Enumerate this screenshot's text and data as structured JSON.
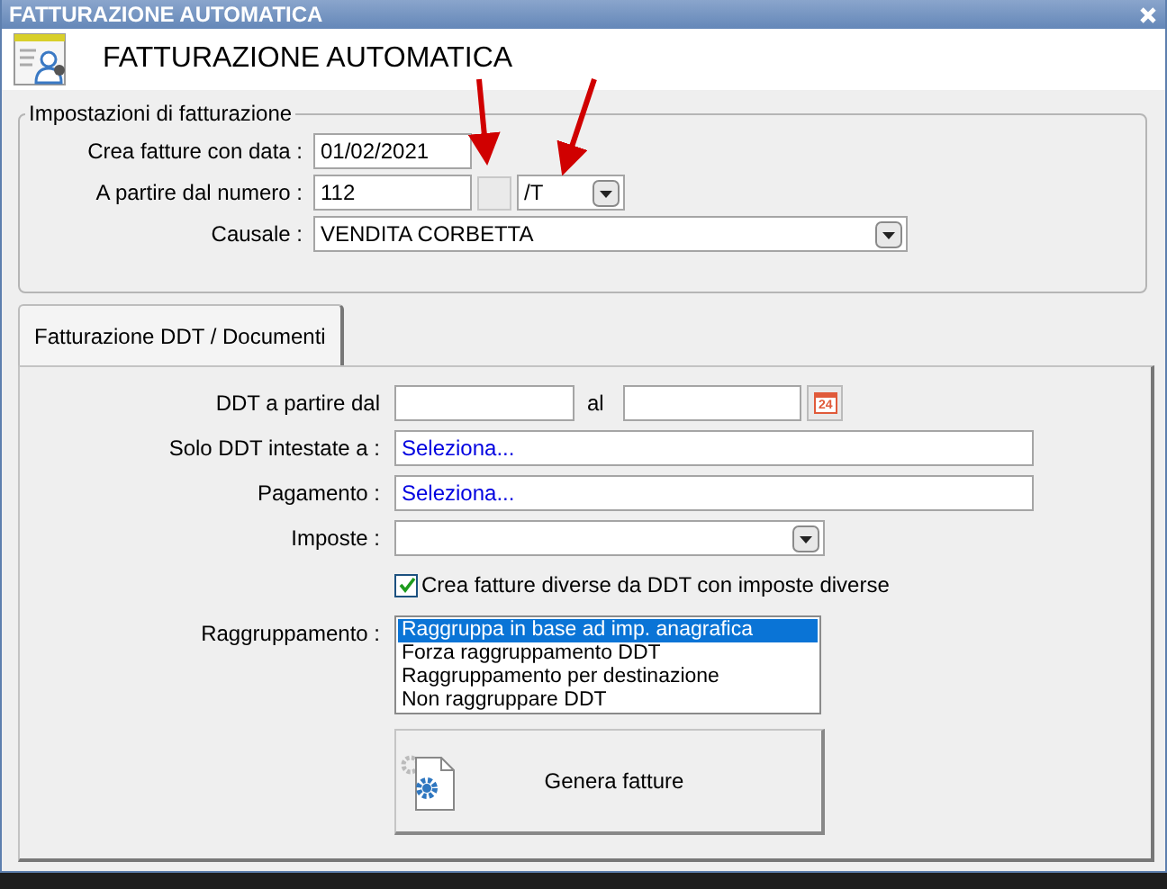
{
  "window": {
    "title": "FATTURAZIONE AUTOMATICA"
  },
  "header": {
    "title": "FATTURAZIONE AUTOMATICA"
  },
  "settings": {
    "legend": "Impostazioni di fatturazione",
    "date_label": "Crea fatture con data :",
    "date_value": "01/02/2021",
    "number_label": "A partire dal numero :",
    "number_value": "112",
    "suffix_value": "/T",
    "reason_label": "Causale :",
    "reason_value": "VENDITA CORBETTA"
  },
  "tabs": [
    {
      "label": "Fatturazione DDT / Documenti",
      "selected": true
    }
  ],
  "ddt": {
    "from_label": "DDT a partire dal",
    "to_label": "al",
    "calendar_day": "24",
    "customer_label": "Solo DDT intestate a :",
    "customer_value": "Seleziona...",
    "payment_label": "Pagamento :",
    "payment_value": "Seleziona...",
    "tax_label": "Imposte :"
  },
  "split_by_tax": {
    "label": "Crea fatture diverse da DDT con imposte diverse",
    "checked": true
  },
  "grouping": {
    "label": "Raggruppamento :",
    "options": [
      {
        "label": "Raggruppa in base ad imp. anagrafica",
        "selected": true
      },
      {
        "label": "Forza raggruppamento DDT",
        "selected": false
      },
      {
        "label": "Raggruppamento per destinazione",
        "selected": false
      },
      {
        "label": "Non raggruppare DDT",
        "selected": false
      }
    ]
  },
  "generate_button": {
    "label": "Genera fatture"
  }
}
